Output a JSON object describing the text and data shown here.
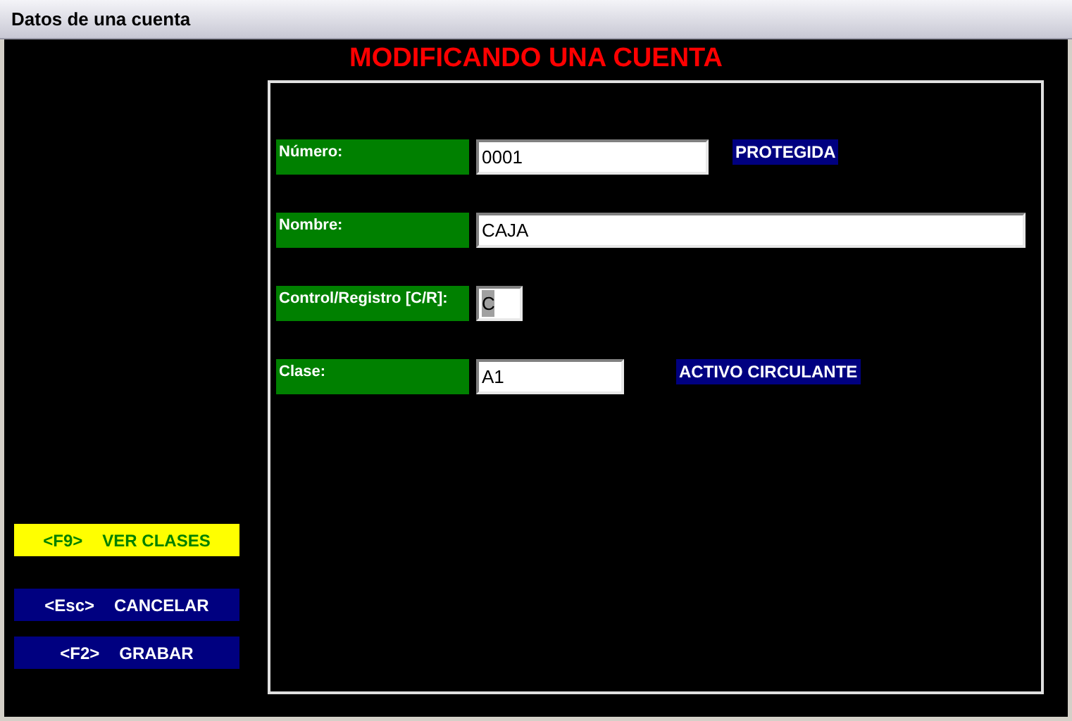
{
  "window": {
    "title": "Datos de una cuenta"
  },
  "heading": "MODIFICANDO UNA CUENTA",
  "fields": [
    {
      "label": "Número:",
      "value": "0001",
      "kind": "code",
      "highlighted": false,
      "tag": "PROTEGIDA"
    },
    {
      "label": "Nombre:",
      "value": "CAJA",
      "kind": "name",
      "highlighted": false
    },
    {
      "label": "Control/Registro [C/R]:",
      "value": "C",
      "kind": "flag",
      "highlighted": true
    },
    {
      "label": "Clase:",
      "value": "A1",
      "kind": "class",
      "highlighted": false,
      "tag": "ACTIVO CIRCULANTE"
    }
  ],
  "buttons": [
    {
      "key": "<F9>",
      "label": "VER CLASES",
      "selected": true
    },
    {
      "key": "<Esc>",
      "label": "CANCELAR",
      "selected": false
    },
    {
      "key": "<F2>",
      "label": "GRABAR",
      "selected": false
    }
  ]
}
